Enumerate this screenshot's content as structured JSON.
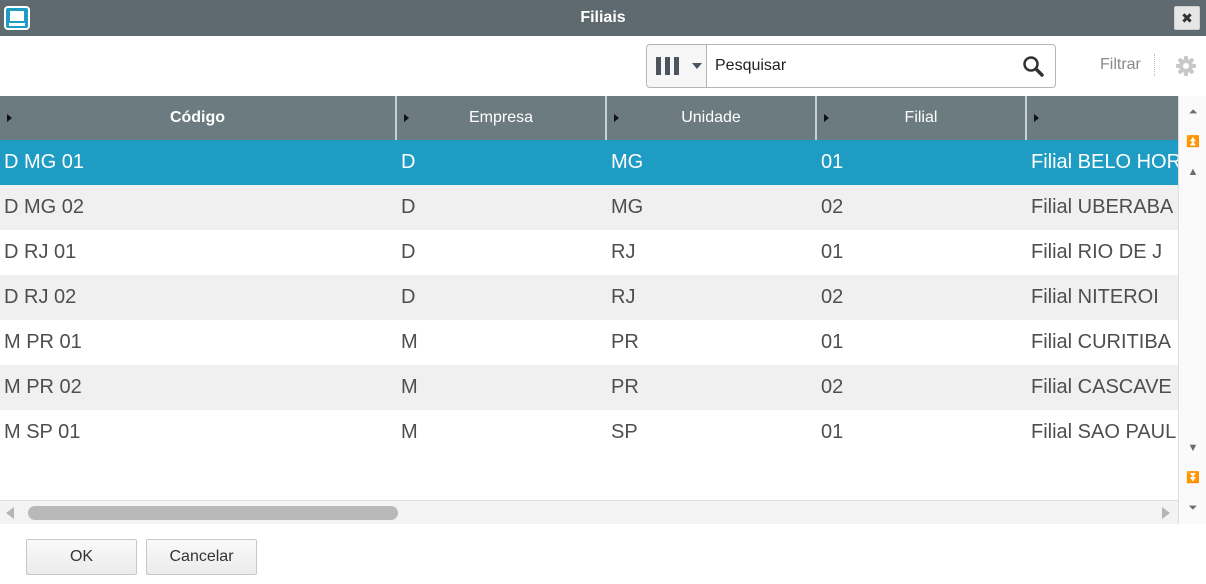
{
  "window": {
    "title": "Filiais"
  },
  "toolbar": {
    "search_placeholder": "Pesquisar",
    "filter_label": "Filtrar"
  },
  "grid": {
    "columns": [
      "Código",
      "Empresa",
      "Unidade",
      "Filial",
      ""
    ],
    "rows": [
      {
        "codigo": "D MG 01",
        "empresa": "D",
        "unidade": "MG",
        "filial": "01",
        "descricao": "Filial BELO HOR"
      },
      {
        "codigo": "D MG 02",
        "empresa": "D",
        "unidade": "MG",
        "filial": "02",
        "descricao": "Filial UBERABA"
      },
      {
        "codigo": "D RJ 01",
        "empresa": "D",
        "unidade": "RJ",
        "filial": "01",
        "descricao": "Filial RIO DE J"
      },
      {
        "codigo": "D RJ 02",
        "empresa": "D",
        "unidade": "RJ",
        "filial": "02",
        "descricao": "Filial NITEROI"
      },
      {
        "codigo": "M PR 01",
        "empresa": "M",
        "unidade": "PR",
        "filial": "01",
        "descricao": "Filial CURITIBA"
      },
      {
        "codigo": "M PR 02",
        "empresa": "M",
        "unidade": "PR",
        "filial": "02",
        "descricao": "Filial CASCAVE"
      },
      {
        "codigo": "M SP 01",
        "empresa": "M",
        "unidade": "SP",
        "filial": "01",
        "descricao": "Filial SAO PAUL"
      }
    ],
    "selected_row": 0
  },
  "footer": {
    "ok_label": "OK",
    "cancel_label": "Cancelar"
  },
  "colors": {
    "titlebar": "#5f6a70",
    "header": "#6b7b80",
    "selection": "#1f9cc3",
    "alt_row": "#f0f0f0"
  },
  "icons": {
    "app": "monitor-icon",
    "close": "close-icon",
    "columns": "columns-icon",
    "search": "search-icon",
    "settings": "gear-icon"
  }
}
